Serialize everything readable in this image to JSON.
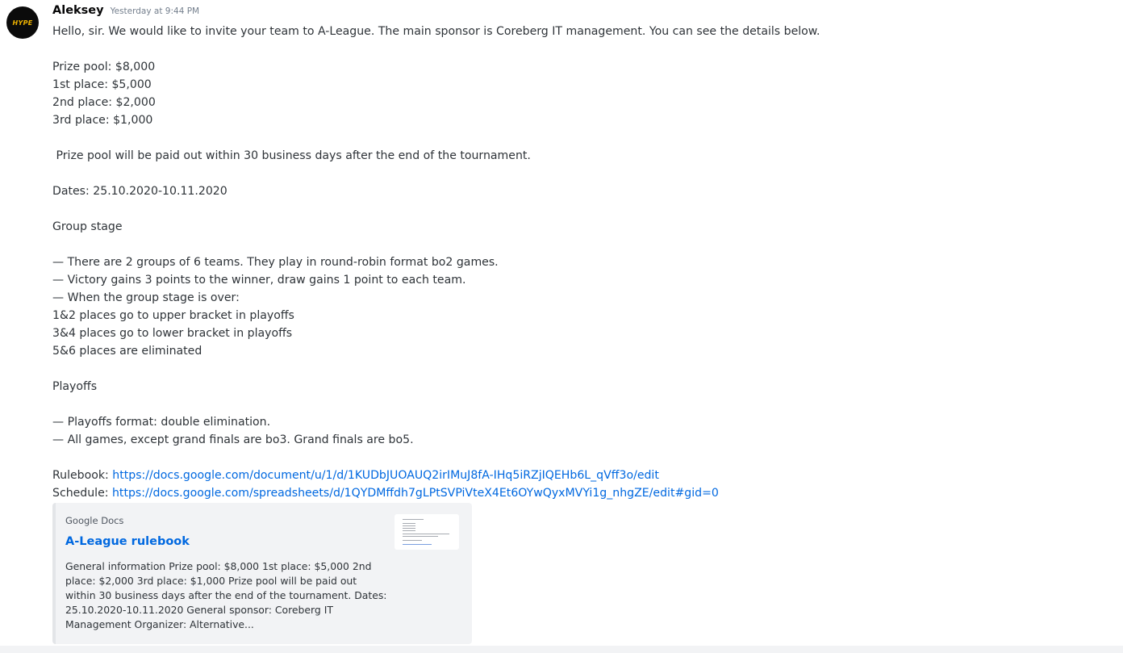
{
  "message": {
    "avatar_text": "HYPE",
    "username": "Aleksey",
    "timestamp": "Yesterday at 9:44 PM",
    "lines": [
      "Hello, sir. We would like to invite your team to A-League. The main sponsor is Coreberg IT management. You can see the details below.",
      "",
      "Prize pool: $8,000",
      "1st place: $5,000",
      "2nd place: $2,000",
      "3rd place: $1,000",
      "",
      " Prize pool will be paid out within 30 business days after the end of the tournament.",
      "",
      "Dates: 25.10.2020-10.11.2020",
      "",
      "Group stage",
      "",
      "— There are 2 groups of 6 teams. They play in round-robin format bo2 games.",
      "— Victory gains 3 points to the winner, draw gains 1 point to each team.",
      "— When the group stage is over:",
      "1&2 places go to upper bracket in playoffs",
      "3&4 places go to lower bracket in playoffs",
      "5&6 places are eliminated",
      "",
      "Playoffs",
      "",
      "— Playoffs format: double elimination.",
      "— All games, except grand finals are bo3. Grand finals are bo5.",
      ""
    ],
    "rulebook_label": "Rulebook: ",
    "rulebook_url": "https://docs.google.com/document/u/1/d/1KUDbJUOAUQ2irIMuJ8fA-IHq5iRZjIQEHb6L_qVff3o/edit",
    "schedule_label": "Schedule: ",
    "schedule_url": "https://docs.google.com/spreadsheets/d/1QYDMffdh7gLPtSVPiVteX4Et6OYwQyxMVYi1g_nhgZE/edit#gid=0"
  },
  "embed": {
    "provider": "Google Docs",
    "title": "A-League rulebook",
    "description": "General information Prize pool: $8,000 1st place: $5,000 2nd place: $2,000 3rd place: $1,000 Prize pool will be paid out within 30 business days after the end of the tournament. Dates: 25.10.2020-10.11.2020 General sponsor: Coreberg IT Management Organizer: Alternative..."
  },
  "colors": {
    "link": "#0068e0",
    "text": "#2e3338",
    "timestamp": "#747f8d",
    "embed_bg": "#f2f3f5"
  }
}
